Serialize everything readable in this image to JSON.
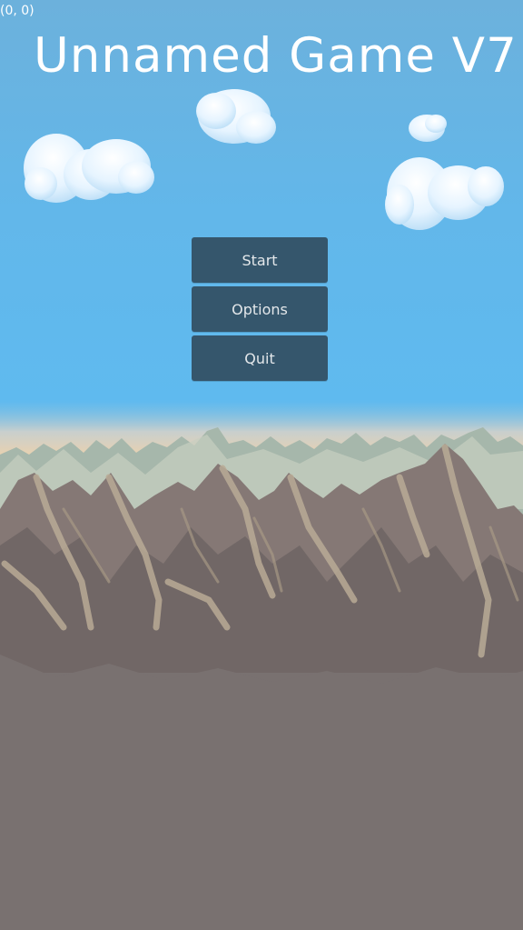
{
  "hud": {
    "coordinates": "(0, 0)"
  },
  "title": "Unnamed Game V7",
  "menu": {
    "start_label": "Start",
    "options_label": "Options",
    "quit_label": "Quit"
  },
  "colors": {
    "sky_top": "#6fb3df",
    "sky_bottom": "#5fb9ee",
    "horizon_glow": "#f3d2a6",
    "distant_mountains": "#9fb4aa",
    "near_mountains": "#7a7170",
    "mountain_highlight": "#b5a793",
    "button_bg": "#35566c",
    "button_text": "#e3e7ea"
  }
}
